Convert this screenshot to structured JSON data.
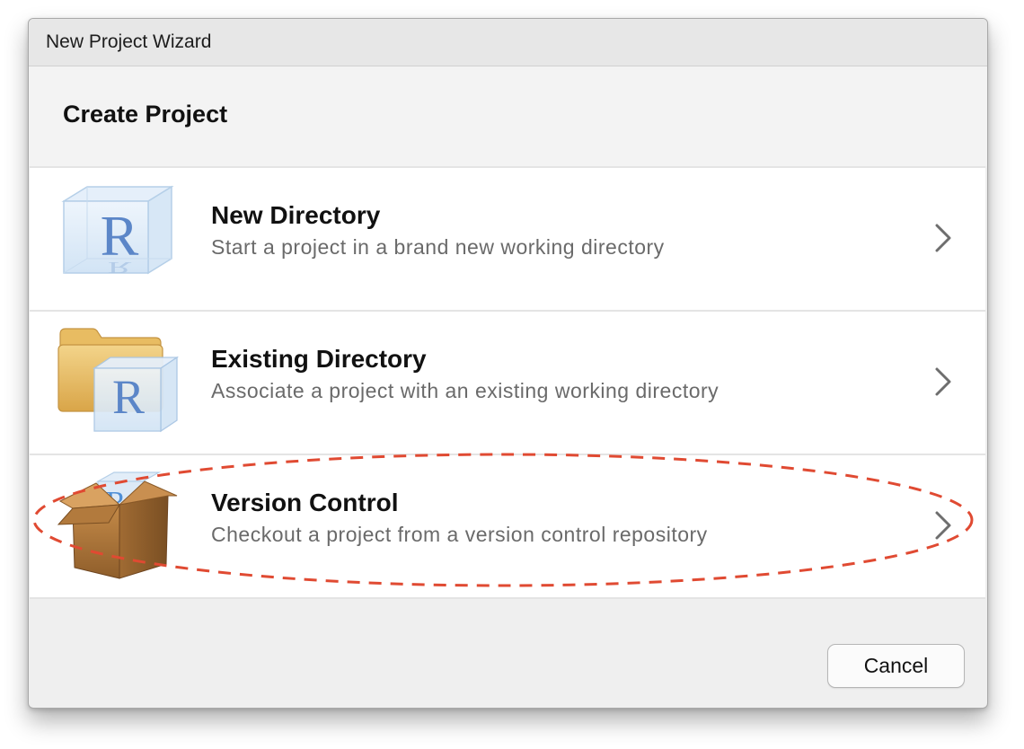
{
  "window": {
    "title": "New Project Wizard"
  },
  "header": {
    "heading": "Create Project"
  },
  "options": [
    {
      "title": "New Directory",
      "subtitle": "Start a project in a brand new working directory",
      "icon": "r-cube-icon"
    },
    {
      "title": "Existing Directory",
      "subtitle": "Associate a project with an existing working directory",
      "icon": "folder-r-cube-icon"
    },
    {
      "title": "Version Control",
      "subtitle": "Checkout a project from a version control repository",
      "icon": "box-icon",
      "highlighted": true
    }
  ],
  "footer": {
    "cancel_label": "Cancel"
  },
  "colors": {
    "highlight": "#e04a32",
    "cube_letter": "#5b86c8",
    "folder": "#e6b95a",
    "box": "#b07a3c"
  }
}
